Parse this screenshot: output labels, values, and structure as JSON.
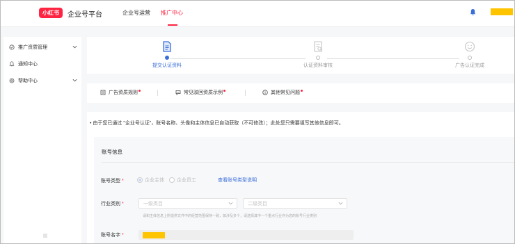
{
  "header": {
    "logo_text": "小红书",
    "platform_title": "企业号平台",
    "nav": {
      "ops": "企业号运营",
      "promo": "推广中心"
    },
    "accent_color": "#ff2442"
  },
  "sidebar": {
    "items": [
      {
        "label": "推广资质管理",
        "icon": "shield-check-icon",
        "expandable": true
      },
      {
        "label": "通知中心",
        "icon": "bell-icon",
        "expandable": false
      },
      {
        "label": "帮助中心",
        "icon": "help-icon",
        "expandable": true
      }
    ]
  },
  "steps": [
    {
      "label": "提交认证资料",
      "icon": "document-icon",
      "active": true
    },
    {
      "label": "认证资料审核",
      "icon": "review-icon",
      "active": false
    },
    {
      "label": "广告认证完成",
      "icon": "smile-icon",
      "active": false
    }
  ],
  "tabs": [
    {
      "label": "广告资质规则",
      "icon": "rules-icon"
    },
    {
      "label": "常见驳回资质示例",
      "icon": "chat-icon"
    },
    {
      "label": "其他常见问题",
      "icon": "info-icon"
    }
  ],
  "notice": "• 由于您已通过 \"企业号认证\"，账号名称、头像和主体信息已自动获取（不可修改）；此处您只需要填写其他信息即可。",
  "form": {
    "section_title": "账号信息",
    "account_type": {
      "label": "账号类型",
      "options": [
        "企业主体",
        "企业员工"
      ],
      "selected": "企业主体",
      "link": "查看账号类型说明"
    },
    "industry": {
      "label": "行业类别",
      "level1_placeholder": "一级类目",
      "level2_placeholder": "二级类目",
      "hint": "请和主体信息上所提供文件中的经营范围保持一致，如涉及多个，请选择其中一个重点行业作为您的账号行业类别"
    },
    "account_name": {
      "label": "账号名字"
    }
  },
  "colors": {
    "link_blue": "#3a6ed9",
    "redaction": "#ffc400"
  }
}
